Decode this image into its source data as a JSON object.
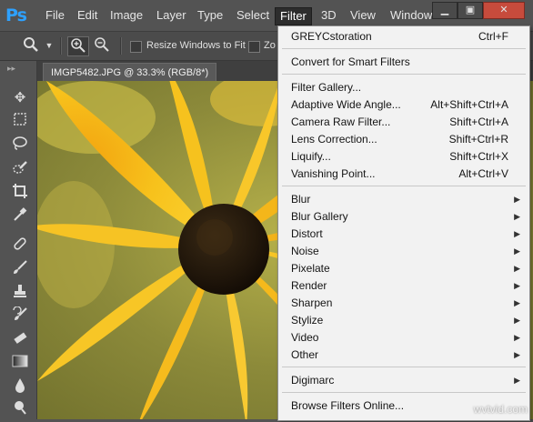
{
  "app": {
    "logo": "Ps"
  },
  "menubar": {
    "items": [
      "File",
      "Edit",
      "Image",
      "Layer",
      "Type",
      "Select",
      "Filter",
      "3D",
      "View",
      "Window"
    ],
    "active": "Filter"
  },
  "window_controls": {
    "minimize": "▁",
    "restore": "▣",
    "close": "✕"
  },
  "options_bar": {
    "resize_windows_label": "Resize Windows to Fit",
    "zoom_all_label": "Zo"
  },
  "document": {
    "tab_title": "IMGP5482.JPG @ 33.3% (RGB/8*)"
  },
  "filter_menu": {
    "groups": [
      [
        {
          "label": "GREYCstoration",
          "shortcut": "Ctrl+F"
        }
      ],
      [
        {
          "label": "Convert for Smart Filters",
          "shortcut": ""
        }
      ],
      [
        {
          "label": "Filter Gallery...",
          "shortcut": ""
        },
        {
          "label": "Adaptive Wide Angle...",
          "shortcut": "Alt+Shift+Ctrl+A"
        },
        {
          "label": "Camera Raw Filter...",
          "shortcut": "Shift+Ctrl+A"
        },
        {
          "label": "Lens Correction...",
          "shortcut": "Shift+Ctrl+R"
        },
        {
          "label": "Liquify...",
          "shortcut": "Shift+Ctrl+X"
        },
        {
          "label": "Vanishing Point...",
          "shortcut": "Alt+Ctrl+V"
        }
      ],
      [
        {
          "label": "Blur",
          "submenu": true
        },
        {
          "label": "Blur Gallery",
          "submenu": true
        },
        {
          "label": "Distort",
          "submenu": true
        },
        {
          "label": "Noise",
          "submenu": true
        },
        {
          "label": "Pixelate",
          "submenu": true
        },
        {
          "label": "Render",
          "submenu": true
        },
        {
          "label": "Sharpen",
          "submenu": true
        },
        {
          "label": "Stylize",
          "submenu": true
        },
        {
          "label": "Video",
          "submenu": true
        },
        {
          "label": "Other",
          "submenu": true
        }
      ],
      [
        {
          "label": "Digimarc",
          "submenu": true
        }
      ],
      [
        {
          "label": "Browse Filters Online...",
          "shortcut": ""
        }
      ]
    ]
  },
  "watermark": "wvtvid.com"
}
